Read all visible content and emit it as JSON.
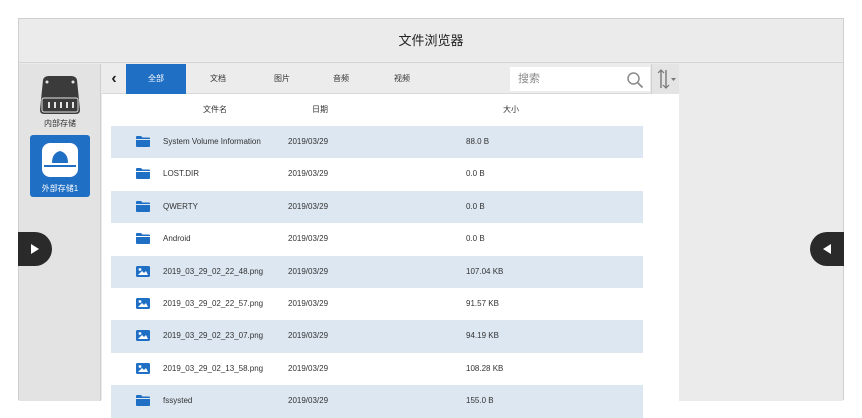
{
  "window": {
    "title": "文件浏览器"
  },
  "sidebar": {
    "items": [
      {
        "label": "内部存储",
        "icon": "hdd-icon",
        "selected": false
      },
      {
        "label": "外部存储1",
        "icon": "usb-drive-icon",
        "selected": true
      }
    ]
  },
  "toolbar": {
    "back_icon": "back-chevron-icon",
    "tabs": [
      {
        "label": "全部",
        "active": true
      },
      {
        "label": "文档",
        "active": false
      },
      {
        "label": "图片",
        "active": false
      },
      {
        "label": "音频",
        "active": false
      },
      {
        "label": "视频",
        "active": false
      }
    ],
    "search": {
      "placeholder": "搜索",
      "icon": "search-icon"
    },
    "sort_icon": "sort-icon"
  },
  "table": {
    "columns": [
      "文件名",
      "日期",
      "大小"
    ],
    "rows": [
      {
        "type": "folder",
        "name": "System Volume Information",
        "date": "2019/03/29",
        "size": "88.0 B"
      },
      {
        "type": "folder",
        "name": "LOST.DIR",
        "date": "2019/03/29",
        "size": "0.0 B"
      },
      {
        "type": "folder",
        "name": "QWERTY",
        "date": "2019/03/29",
        "size": "0.0 B"
      },
      {
        "type": "folder",
        "name": "Android",
        "date": "2019/03/29",
        "size": "0.0 B"
      },
      {
        "type": "image",
        "name": "2019_03_29_02_22_48.png",
        "date": "2019/03/29",
        "size": "107.04 KB"
      },
      {
        "type": "image",
        "name": "2019_03_29_02_22_57.png",
        "date": "2019/03/29",
        "size": "91.57 KB"
      },
      {
        "type": "image",
        "name": "2019_03_29_02_23_07.png",
        "date": "2019/03/29",
        "size": "94.19 KB"
      },
      {
        "type": "image",
        "name": "2019_03_29_02_13_58.png",
        "date": "2019/03/29",
        "size": "108.28 KB"
      },
      {
        "type": "folder",
        "name": "fssysted",
        "date": "2019/03/29",
        "size": "155.0 B"
      }
    ]
  },
  "nav": {
    "left_icon": "play-right-icon",
    "right_icon": "play-left-icon"
  },
  "colors": {
    "accent": "#1f6fc4",
    "row_alt": "#dce7f1",
    "nav": "#2a2a2a"
  }
}
